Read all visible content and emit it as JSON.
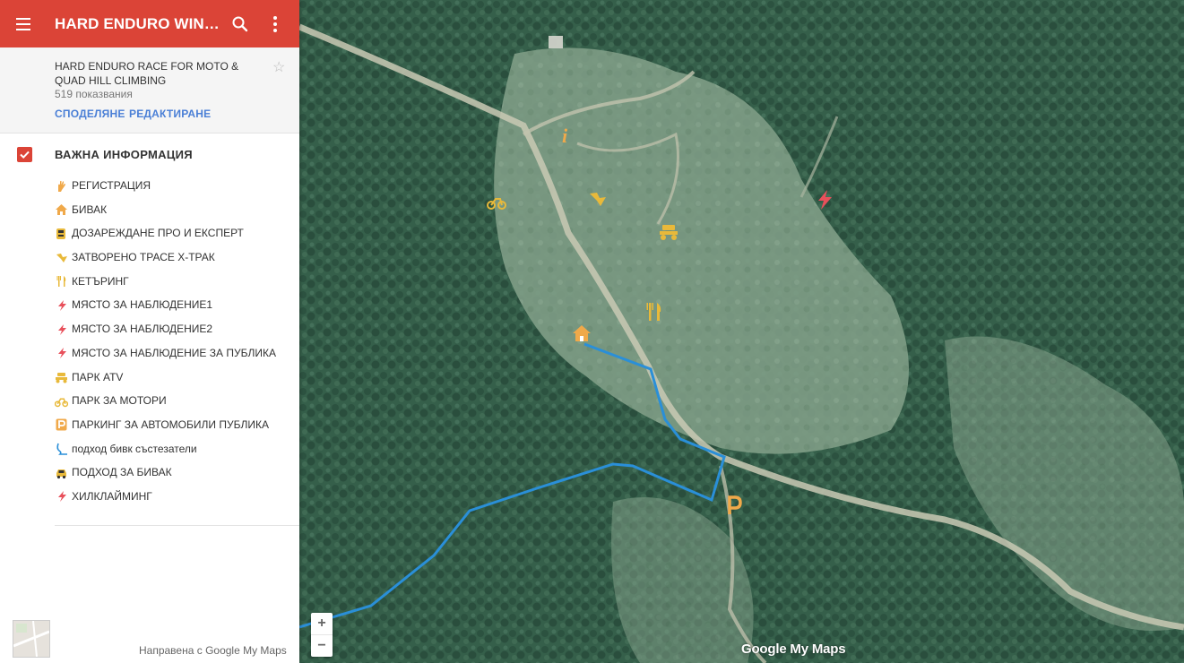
{
  "app": {
    "title": "HARD ENDURO WINBE…",
    "map_name": "HARD ENDURO RACE FOR MOTO & QUAD HILL CLIMBING",
    "views": "519 показвания",
    "share_label": "СПОДЕЛЯНЕ",
    "edit_label": "РЕДАКТИРАНЕ"
  },
  "layer": {
    "title": "ВАЖНА ИНФОРМАЦИЯ",
    "checked": true,
    "items": [
      {
        "label": "РЕГИСТРАЦИЯ",
        "icon": "hand-icon",
        "color": "#f0a94a"
      },
      {
        "label": "БИВАК",
        "icon": "home-icon",
        "color": "#f0a94a"
      },
      {
        "label": "ДОЗАРЕЖДАНЕ ПРО И ЕКСПЕРТ",
        "icon": "fuel-icon",
        "color": "#e8b93a"
      },
      {
        "label": "ЗАТВОРЕНО ТРАСЕ X-ТРАК",
        "icon": "closed-road-icon",
        "color": "#e8b93a"
      },
      {
        "label": "КЕТЪРИНГ",
        "icon": "fork-knife-icon",
        "color": "#e8b93a"
      },
      {
        "label": "МЯСТО ЗА НАБЛЮДЕНИЕ1",
        "icon": "bolt-icon",
        "color": "#e8505b"
      },
      {
        "label": "МЯСТО ЗА НАБЛЮДЕНИЕ2",
        "icon": "bolt-icon",
        "color": "#e8505b"
      },
      {
        "label": "МЯСТО ЗА НАБЛЮДЕНИЕ ЗА ПУБЛИКА",
        "icon": "bolt-icon",
        "color": "#e8505b"
      },
      {
        "label": "ПАРК ATV",
        "icon": "atv-icon",
        "color": "#e8b93a"
      },
      {
        "label": "ПАРК ЗА МОТОРИ",
        "icon": "motorbike-icon",
        "color": "#e8b93a"
      },
      {
        "label": "ПАРКИНГ ЗА АВТОМОБИЛИ ПУБЛИКА",
        "icon": "parking-icon",
        "color": "#f0a94a"
      },
      {
        "label": "подход бивк състезатели",
        "icon": "route-icon",
        "color": "#2a8fd8"
      },
      {
        "label": "ПОДХОД ЗА БИВАК",
        "icon": "car-icon",
        "color": "#e8b93a"
      },
      {
        "label": "ХИЛКЛАЙМИНГ",
        "icon": "bolt-icon",
        "color": "#e8505b"
      }
    ]
  },
  "footer": {
    "credit": "Направена с Google My Maps"
  },
  "map": {
    "route_color": "#2a8fd8",
    "logo": "Google My Maps",
    "zoom_in": "+",
    "zoom_out": "−"
  },
  "colors": {
    "brand": "#db4437",
    "link": "#4a7fd6"
  }
}
